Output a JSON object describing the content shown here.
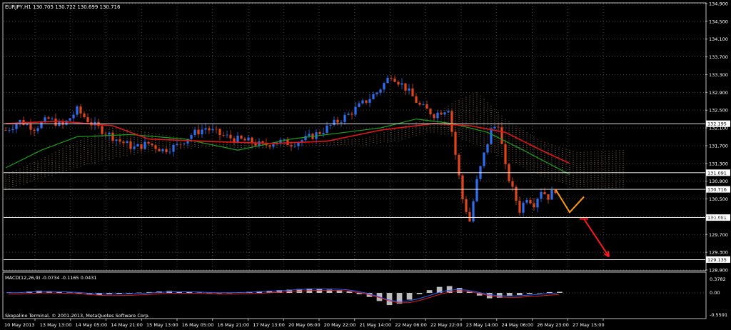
{
  "header": {
    "title": "EURJPY,H1  130.705 130.722 130.699 130.716"
  },
  "footer": {
    "copyright": "Skopalino Terminal, © 2001-2013, MetaQuotes Software Corp."
  },
  "macd": {
    "label": "MACD(12,26,9) -0.0734 -0.1165 0.0431",
    "scale": [
      "0.3782",
      "0.00",
      "-0.5591"
    ]
  },
  "colors": {
    "bull": "#2f6df0",
    "bear": "#e0451f",
    "ma_red": "#e01515",
    "ma_green": "#1aa01a",
    "cloud": "#d8b090",
    "hline": "#ffffff",
    "arrow_orange": "#ff9a10",
    "arrow_red": "#ff1a1a"
  },
  "chart_data": {
    "type": "candlestick",
    "symbol": "EURJPY",
    "timeframe": "H1",
    "ylim": [
      129.135,
      134.9
    ],
    "yticks": [
      "134.900",
      "134.500",
      "134.100",
      "133.700",
      "133.300",
      "132.900",
      "132.500",
      "132.100",
      "131.700",
      "131.300",
      "130.900",
      "130.500",
      "130.100",
      "129.700",
      "129.300",
      "128.900"
    ],
    "xticks": [
      "10 May 2013",
      "13 May 13:00",
      "14 May 05:00",
      "14 May 21:00",
      "15 May 13:00",
      "16 May 05:00",
      "16 May 21:00",
      "17 May 13:00",
      "20 May 06:00",
      "20 May 22:00",
      "21 May 14:00",
      "22 May 06:00",
      "22 May 22:00",
      "23 May 14:00",
      "24 May 06:00",
      "26 May 23:00",
      "27 May 15:00"
    ],
    "levels": [
      {
        "value": 132.195,
        "label": "132.195"
      },
      {
        "value": 131.091,
        "label": "131.091"
      },
      {
        "value": 130.716,
        "label": "130.716"
      },
      {
        "value": 130.081,
        "label": "130.081"
      },
      {
        "value": 129.135,
        "label": "129.135"
      }
    ],
    "price_path": [
      [
        0,
        132.05
      ],
      [
        4,
        132.25
      ],
      [
        8,
        132.1
      ],
      [
        12,
        132.3
      ],
      [
        16,
        132.15
      ],
      [
        20,
        132.5
      ],
      [
        24,
        132.2
      ],
      [
        28,
        132.0
      ],
      [
        32,
        131.8
      ],
      [
        36,
        131.65
      ],
      [
        40,
        131.75
      ],
      [
        44,
        131.6
      ],
      [
        48,
        131.7
      ],
      [
        52,
        131.95
      ],
      [
        56,
        132.1
      ],
      [
        60,
        131.95
      ],
      [
        64,
        131.85
      ],
      [
        68,
        131.8
      ],
      [
        72,
        131.7
      ],
      [
        76,
        131.8
      ],
      [
        80,
        131.75
      ],
      [
        84,
        131.85
      ],
      [
        88,
        132.0
      ],
      [
        92,
        132.2
      ],
      [
        96,
        132.4
      ],
      [
        100,
        132.65
      ],
      [
        104,
        132.9
      ],
      [
        108,
        133.3
      ],
      [
        112,
        133.0
      ],
      [
        116,
        132.6
      ],
      [
        120,
        132.4
      ],
      [
        124,
        132.55
      ],
      [
        126,
        131.5
      ],
      [
        128,
        130.5
      ],
      [
        130,
        130.0
      ],
      [
        132,
        130.9
      ],
      [
        134,
        131.5
      ],
      [
        136,
        132.05
      ],
      [
        138,
        132.2
      ],
      [
        140,
        131.2
      ],
      [
        142,
        130.7
      ],
      [
        144,
        130.25
      ],
      [
        146,
        130.55
      ],
      [
        148,
        130.4
      ],
      [
        150,
        130.7
      ],
      [
        152,
        130.55
      ],
      [
        154,
        130.72
      ]
    ],
    "ma_red": [
      [
        0,
        132.2
      ],
      [
        15,
        132.25
      ],
      [
        30,
        132.15
      ],
      [
        40,
        131.85
      ],
      [
        55,
        131.8
      ],
      [
        75,
        131.75
      ],
      [
        90,
        131.8
      ],
      [
        105,
        132.05
      ],
      [
        120,
        132.2
      ],
      [
        130,
        132.15
      ],
      [
        140,
        132.0
      ],
      [
        150,
        131.6
      ],
      [
        158,
        131.3
      ]
    ],
    "ma_green": [
      [
        0,
        131.2
      ],
      [
        10,
        131.6
      ],
      [
        20,
        131.9
      ],
      [
        35,
        131.95
      ],
      [
        50,
        131.85
      ],
      [
        65,
        131.6
      ],
      [
        80,
        131.85
      ],
      [
        95,
        132.0
      ],
      [
        105,
        132.1
      ],
      [
        115,
        132.3
      ],
      [
        125,
        132.2
      ],
      [
        135,
        132.0
      ],
      [
        145,
        131.6
      ],
      [
        158,
        131.05
      ]
    ],
    "cloud_upper": [
      [
        0,
        131.05
      ],
      [
        10,
        131.4
      ],
      [
        20,
        131.8
      ],
      [
        30,
        132.1
      ],
      [
        40,
        132.0
      ],
      [
        55,
        131.8
      ],
      [
        70,
        131.75
      ],
      [
        85,
        131.8
      ],
      [
        100,
        131.85
      ],
      [
        110,
        132.1
      ],
      [
        118,
        132.3
      ],
      [
        126,
        132.7
      ],
      [
        132,
        132.9
      ],
      [
        140,
        132.3
      ],
      [
        150,
        131.8
      ],
      [
        160,
        131.55
      ],
      [
        173,
        131.6
      ]
    ],
    "cloud_lower": [
      [
        0,
        130.7
      ],
      [
        10,
        130.95
      ],
      [
        20,
        131.2
      ],
      [
        30,
        131.4
      ],
      [
        40,
        131.55
      ],
      [
        55,
        131.65
      ],
      [
        70,
        131.6
      ],
      [
        85,
        131.7
      ],
      [
        100,
        131.7
      ],
      [
        110,
        131.8
      ],
      [
        118,
        132.0
      ],
      [
        126,
        131.9
      ],
      [
        132,
        131.7
      ],
      [
        140,
        131.4
      ],
      [
        150,
        131.0
      ],
      [
        160,
        130.75
      ],
      [
        173,
        130.7
      ]
    ],
    "forecast": {
      "orange": [
        [
          154,
          130.72
        ],
        [
          158,
          130.2
        ],
        [
          162,
          130.55
        ]
      ],
      "red": [
        [
          162,
          130.05
        ],
        [
          169,
          129.2
        ]
      ]
    },
    "macd_hist": [
      0.02,
      0.01,
      0.05,
      0.08,
      0.06,
      0.03,
      0.01,
      -0.02,
      -0.05,
      -0.08,
      -0.06,
      -0.04,
      -0.02,
      0.01,
      0.03,
      0.05,
      0.07,
      0.05,
      0.03,
      0.01,
      -0.01,
      -0.02,
      0.0,
      0.02,
      0.04,
      0.06,
      0.08,
      0.1,
      0.12,
      0.14,
      0.16,
      0.14,
      0.12,
      0.1,
      0.05,
      -0.05,
      -0.15,
      -0.3,
      -0.45,
      -0.4,
      -0.25,
      -0.05,
      0.1,
      0.22,
      0.25,
      0.18,
      0.05,
      -0.1,
      -0.2,
      -0.18,
      -0.12,
      -0.08,
      -0.04,
      0.0,
      0.03,
      0.04
    ]
  }
}
